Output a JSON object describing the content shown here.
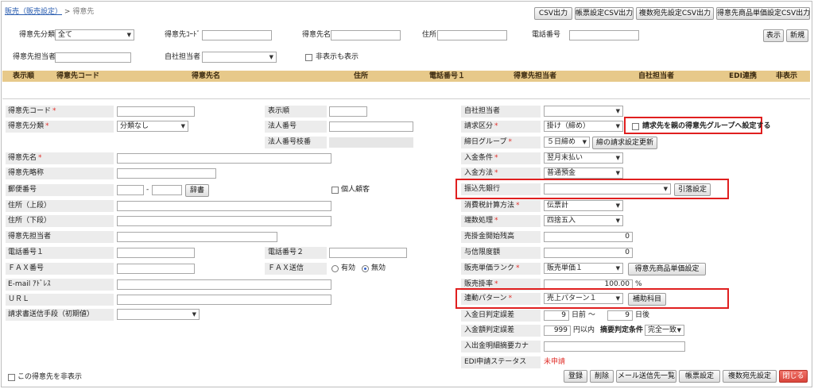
{
  "breadcrumb": {
    "parent": "販売（販売設定）",
    "separator": ">",
    "current": "得意先"
  },
  "top_buttons": {
    "csv": "CSV出力",
    "form_csv": "帳票設定CSV出力",
    "multi_csv": "複数宛先設定CSV出力",
    "price_csv": "得意先商品単価設定CSV出力"
  },
  "search": {
    "category_label": "得意先分類",
    "category_value": "全て",
    "code_label": "得意先ｺｰﾄﾞ",
    "code_value": "",
    "name_label": "得意先名",
    "name_value": "",
    "address_label": "住所",
    "address_value": "",
    "phone_label": "電話番号",
    "phone_value": "",
    "client_staff_label": "得意先担当者",
    "client_staff_value": "",
    "own_staff_label": "自社担当者",
    "own_staff_value": "",
    "show_hidden_label": "非表示も表示",
    "show_btn": "表示",
    "new_btn": "新規"
  },
  "table_headers": [
    "表示順",
    "得意先コード",
    "得意先名",
    "住所",
    "電話番号１",
    "得意先担当者",
    "自社担当者",
    "EDI連携",
    "非表示"
  ],
  "form": {
    "code_label": "得意先コード",
    "code_value": "",
    "order_label": "表示順",
    "order_value": "",
    "own_staff_label": "自社担当者",
    "own_staff_value": "",
    "category_label": "得意先分類",
    "category_value": "分類なし",
    "corp_no_label": "法人番号",
    "corp_no_value": "",
    "billing_label": "請求区分",
    "billing_value": "掛け（締め）",
    "parent_group_label": "請求先を親の得意先グループへ設定する",
    "corp_branch_label": "法人番号枝番",
    "corp_branch_value": "",
    "closing_group_label": "締日グループ",
    "closing_group_value": "５日締め",
    "closing_update_btn": "締の請求設定更新",
    "name_label": "得意先名",
    "name_value": "",
    "payment_cond_label": "入金条件",
    "payment_cond_value": "翌月末払い",
    "short_name_label": "得意先略称",
    "short_name_value": "",
    "payment_method_label": "入金方法",
    "payment_method_value": "普通預金",
    "zip_label": "郵便番号",
    "zip_1": "",
    "zip_sep": "-",
    "zip_2": "",
    "dict_btn": "辞書",
    "individual_label": "個人顧客",
    "bank_label": "振込先銀行",
    "bank_value": "",
    "withdraw_btn": "引落設定",
    "addr1_label": "住所（上段）",
    "addr1_value": "",
    "tax_calc_label": "消費税計算方法",
    "tax_calc_value": "伝票計",
    "addr2_label": "住所（下段）",
    "addr2_value": "",
    "rounding_label": "端数処理",
    "rounding_value": "四捨五入",
    "client_staff_label": "得意先担当者",
    "client_staff_value": "",
    "ar_balance_label": "売掛金開始残高",
    "ar_balance_value": "0",
    "tel1_label": "電話番号１",
    "tel1_value": "",
    "tel2_label": "電話番号２",
    "tel2_value": "",
    "credit_label": "与信限度額",
    "credit_value": "0",
    "fax_label": "ＦＡＸ番号",
    "fax_value": "",
    "fax_send_label": "ＦＡＸ送信",
    "fax_on": "有効",
    "fax_off": "無効",
    "price_rank_label": "販売単価ランク",
    "price_rank_value": "販売単価１",
    "price_setting_btn": "得意先商品単価設定",
    "email_label": "E-mail ｱﾄﾞﾚｽ",
    "email_value": "",
    "sales_rate_label": "販売掛率",
    "sales_rate_value": "100.00",
    "sales_rate_unit": "%",
    "url_label": "ＵＲＬ",
    "url_value": "",
    "link_pattern_label": "連動パターン",
    "link_pattern_value": "売上パターン１",
    "link_account_btn": "補助科目",
    "invoice_method_label": "請求書送信手段（初期値）",
    "invoice_method_value": "",
    "pay_date_tol_label": "入金日判定誤差",
    "pay_date_before": "9",
    "pay_date_before_unit": "日前 ～",
    "pay_date_after": "9",
    "pay_date_after_unit": "日後",
    "pay_amount_tol_label": "入金額判定誤差",
    "pay_amount_value": "999",
    "pay_amount_unit": "円以内",
    "summary_cond_label": "摘要判定条件",
    "summary_cond_value": "完全一致",
    "summary_kana_label": "入出金明細摘要カナ",
    "summary_kana_value": "",
    "edi_status_label": "EDI申請ステータス",
    "edi_status_value": "未申請",
    "hide_client_label": "この得意先を非表示"
  },
  "bottom_buttons": {
    "register": "登録",
    "delete": "削除",
    "mail_list": "メール送信先一覧",
    "form_setting": "帳票設定",
    "multi_dest": "複数宛先設定",
    "close": "閉じる"
  },
  "colors": {
    "header_bg": "#e7c98a",
    "required": "#e0302b",
    "highlight": "#e01f1f",
    "edi_status": "#e0302b",
    "close_btn": "#d9453b"
  }
}
